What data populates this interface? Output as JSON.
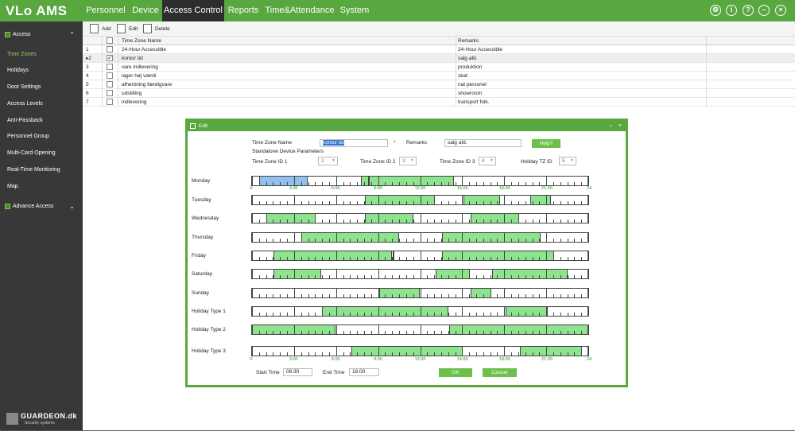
{
  "app": {
    "logo": "VLo AMS",
    "nav": [
      {
        "label": "Personnel",
        "active": false
      },
      {
        "label": "Device",
        "active": false
      },
      {
        "label": "Access Control",
        "active": true
      },
      {
        "label": "Reports",
        "active": false
      },
      {
        "label": "Time&Attendance",
        "active": false
      },
      {
        "label": "System",
        "active": false
      }
    ],
    "top_icons": [
      "gear-icon",
      "info-icon",
      "help-icon",
      "minimize-icon",
      "close-icon"
    ]
  },
  "sidebar": {
    "section_access": "Access",
    "items": [
      {
        "label": "Time Zones",
        "active": true
      },
      {
        "label": "Holidays",
        "active": false
      },
      {
        "label": "Door Settings",
        "active": false
      },
      {
        "label": "Access Levels",
        "active": false
      },
      {
        "label": "Anti-Passback",
        "active": false
      },
      {
        "label": "Personnel Group",
        "active": false
      },
      {
        "label": "Multi-Card Opening",
        "active": false
      },
      {
        "label": "Real-Time Monitoring",
        "active": false
      },
      {
        "label": "Map",
        "active": false
      }
    ],
    "section_advance": "Advance Access",
    "brand_name": "GUARDEON.dk",
    "brand_sub": "Security systems"
  },
  "toolbar": {
    "add": "Add",
    "edit": "Edit",
    "delete": "Delete"
  },
  "table": {
    "headers": {
      "name": "Time Zone Name",
      "remarks": "Remarks"
    },
    "rows": [
      {
        "num": "1",
        "name": "24-Hour Accessible",
        "remarks": "24-Hour Accessible",
        "checked": false,
        "current": false
      },
      {
        "num": "2",
        "name": "kontor tid",
        "remarks": "salg afd.",
        "checked": true,
        "current": true
      },
      {
        "num": "3",
        "name": "vare indlevering",
        "remarks": "produktion",
        "checked": false,
        "current": false
      },
      {
        "num": "4",
        "name": "lager høj værdi",
        "remarks": "skat",
        "checked": false,
        "current": false
      },
      {
        "num": "5",
        "name": "afhentning færdigvare",
        "remarks": "nat personel",
        "checked": false,
        "current": false
      },
      {
        "num": "6",
        "name": "udstilling",
        "remarks": "showroom",
        "checked": false,
        "current": false
      },
      {
        "num": "7",
        "name": "indlevering",
        "remarks": "transport folk.",
        "checked": false,
        "current": false
      }
    ]
  },
  "dialog": {
    "title": "Edit",
    "tz_name_label": "Time Zone Name",
    "tz_name_value": "kontor tid",
    "required_mark": "*",
    "remarks_label": "Remarks",
    "remarks_value": "salg afd.",
    "help_button": "Help?",
    "standalone_label": "Standalone Device Parameters",
    "tz_ids": [
      {
        "label": "Time Zone ID 1",
        "value": "2"
      },
      {
        "label": "Time Zone ID 2",
        "value": "3"
      },
      {
        "label": "Time Zone ID 3",
        "value": "4"
      },
      {
        "label": "Holiday TZ ID",
        "value": "5"
      }
    ],
    "axis_labels": [
      "0",
      "3:00",
      "6:00",
      "9:00",
      "12:00",
      "15:00",
      "18:00",
      "21:00",
      "24"
    ],
    "days": [
      {
        "label": "Monday",
        "segments": [
          [
            0.6,
            5.0,
            "blue"
          ],
          [
            9.7,
            18.0,
            "green"
          ]
        ],
        "marks": [
          10.3
        ]
      },
      {
        "label": "Tuesday",
        "segments": [
          [
            10.0,
            16.3,
            "green"
          ],
          [
            18.8,
            22.1,
            "green"
          ],
          [
            24.7,
            26.6,
            "green"
          ]
        ],
        "marks": []
      },
      {
        "label": "Wednesday",
        "segments": [
          [
            1.3,
            5.7,
            "green"
          ],
          [
            10.0,
            14.4,
            "green"
          ],
          [
            19.4,
            23.8,
            "green"
          ]
        ],
        "marks": []
      },
      {
        "label": "Thursday",
        "segments": [
          [
            4.4,
            13.1,
            "green"
          ],
          [
            16.9,
            25.7,
            "green"
          ]
        ],
        "marks": []
      },
      {
        "label": "Friday",
        "segments": [
          [
            1.9,
            12.5,
            "green"
          ],
          [
            16.9,
            26.9,
            "green"
          ]
        ],
        "marks": [
          12.5
        ]
      },
      {
        "label": "Saturday",
        "segments": [
          [
            1.9,
            6.2,
            "green"
          ],
          [
            16.3,
            19.4,
            "green"
          ],
          [
            21.3,
            28.1,
            "green"
          ]
        ],
        "marks": []
      },
      {
        "label": "Sunday",
        "segments": [
          [
            11.3,
            15.0,
            "green"
          ],
          [
            19.4,
            21.3,
            "green"
          ]
        ],
        "marks": []
      },
      {
        "label": "Holiday Type 1",
        "segments": [
          [
            6.2,
            17.5,
            "green"
          ],
          [
            22.5,
            26.3,
            "green"
          ]
        ],
        "marks": []
      },
      {
        "label": "Holiday Type 2",
        "segments": [
          [
            0.0,
            7.5,
            "green"
          ],
          [
            17.5,
            30.0,
            "green"
          ]
        ],
        "marks": []
      },
      {
        "label": "Holiday Type 3",
        "segments": [
          [
            8.8,
            18.8,
            "green"
          ],
          [
            23.8,
            29.4,
            "green"
          ]
        ],
        "marks": []
      }
    ],
    "start_time_label": "Start Time",
    "start_time_value": "08:30",
    "end_time_label": "End Time",
    "end_time_value": "18:00",
    "ok_button": "OK",
    "cancel_button": "Cancel"
  }
}
